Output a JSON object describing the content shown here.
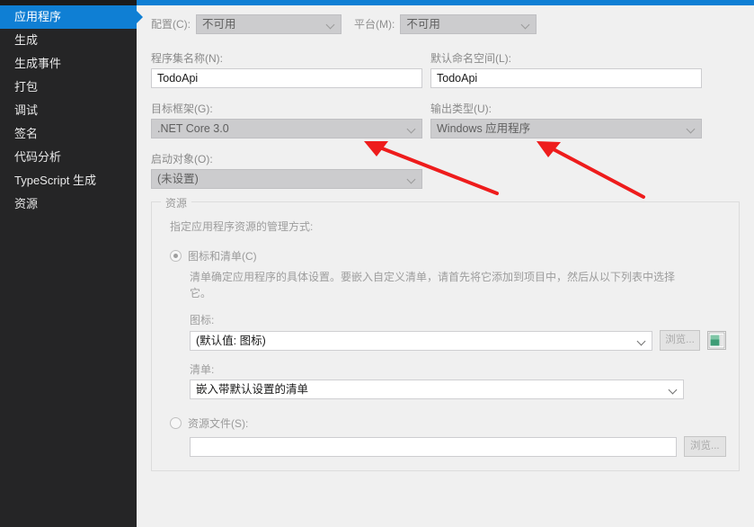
{
  "sidebar": {
    "items": [
      {
        "label": "应用程序",
        "selected": true
      },
      {
        "label": "生成",
        "selected": false
      },
      {
        "label": "生成事件",
        "selected": false
      },
      {
        "label": "打包",
        "selected": false
      },
      {
        "label": "调试",
        "selected": false
      },
      {
        "label": "签名",
        "selected": false
      },
      {
        "label": "代码分析",
        "selected": false
      },
      {
        "label": "TypeScript 生成",
        "selected": false
      },
      {
        "label": "资源",
        "selected": false
      }
    ]
  },
  "toolbar": {
    "configuration_label": "配置(C):",
    "configuration_value": "不可用",
    "platform_label": "平台(M):",
    "platform_value": "不可用"
  },
  "fields": {
    "assembly_name_label": "程序集名称(N):",
    "assembly_name_value": "TodoApi",
    "default_namespace_label": "默认命名空间(L):",
    "default_namespace_value": "TodoApi",
    "target_framework_label": "目标框架(G):",
    "target_framework_value": ".NET Core 3.0",
    "output_type_label": "输出类型(U):",
    "output_type_value": "Windows 应用程序",
    "startup_object_label": "启动对象(O):",
    "startup_object_value": "(未设置)"
  },
  "resources": {
    "group_title": "资源",
    "description": "指定应用程序资源的管理方式:",
    "icon_manifest_radio_label": "图标和清单(C)",
    "manifest_paragraph": "清单确定应用程序的具体设置。要嵌入自定义清单，请首先将它添加到项目中，然后从以下列表中选择它。",
    "icon_label": "图标:",
    "icon_value": "(默认值: 图标)",
    "icon_browse_label": "浏览...",
    "manifest_label": "清单:",
    "manifest_value": "嵌入带默认设置的清单",
    "resource_file_radio_label": "资源文件(S):",
    "resource_file_value": "",
    "resource_file_browse_label": "浏览..."
  },
  "colors": {
    "accent": "#0f7fd4",
    "sidebar_bg": "#252526",
    "panel_bg": "#f0f0f0",
    "annotation": "#ee1c1c"
  }
}
